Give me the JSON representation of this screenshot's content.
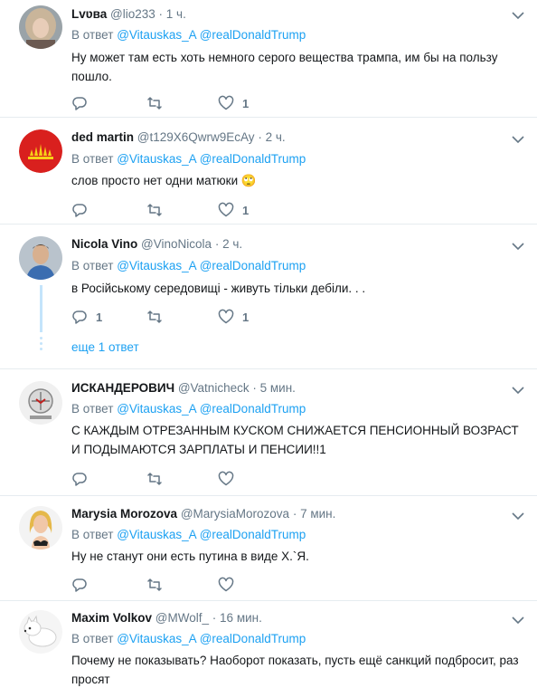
{
  "tweets": [
    {
      "name": "Lvʋва",
      "handle": "@lio233",
      "dot": "·",
      "time": "1 ч.",
      "reply_prefix": "В ответ",
      "mention1": "@Vitauskas_A",
      "mention2": "@realDonaldTrump",
      "text": "Ну может там есть хоть немного серого вещества трампа, им бы на пользу пошло.",
      "reply_count": "",
      "retweet_count": "",
      "like_count": "1"
    },
    {
      "name": "ded martin",
      "handle": "@t129X6Qwrw9EcAy",
      "dot": "·",
      "time": "2 ч.",
      "reply_prefix": "В ответ",
      "mention1": "@Vitauskas_A",
      "mention2": "@realDonaldTrump",
      "text": "слов просто нет одни матюки",
      "emoji": "🙄",
      "reply_count": "",
      "retweet_count": "",
      "like_count": "1"
    },
    {
      "name": "Nicola Vino",
      "handle": "@VinoNicola",
      "dot": "·",
      "time": "2 ч.",
      "reply_prefix": "В ответ",
      "mention1": "@Vitauskas_A",
      "mention2": "@realDonaldTrump",
      "text": "в Російському середовищі - живуть тільки дебіли. . .",
      "reply_count": "1",
      "retweet_count": "",
      "like_count": "1",
      "more_replies": "еще 1 ответ"
    },
    {
      "name": "ИСКАНДЕРОВИЧ",
      "handle": "@Vatnicheck",
      "dot": "·",
      "time": "5 мин.",
      "reply_prefix": "В ответ",
      "mention1": "@Vitauskas_A",
      "mention2": "@realDonaldTrump",
      "text": "С КАЖДЫМ ОТРЕЗАННЫМ КУСКОМ СНИЖАЕТСЯ ПЕНСИОННЫЙ ВОЗРАСТ И ПОДЫМАЮТСЯ ЗАРПЛАТЫ И ПЕНСИИ!!1",
      "reply_count": "",
      "retweet_count": "",
      "like_count": ""
    },
    {
      "name": "Marysia Morozova",
      "handle": "@MarysiaMorozova",
      "dot": "·",
      "time": "7 мин.",
      "reply_prefix": "В ответ",
      "mention1": "@Vitauskas_A",
      "mention2": "@realDonaldTrump",
      "text": "Ну не станут они есть путина в виде Х.`Я.",
      "reply_count": "",
      "retweet_count": "",
      "like_count": ""
    },
    {
      "name": "Maxim Volkov",
      "handle": "@MWolf_",
      "dot": "·",
      "time": "16 мин.",
      "reply_prefix": "В ответ",
      "mention1": "@Vitauskas_A",
      "mention2": "@realDonaldTrump",
      "text": "Почему не показывать? Наоборот показать, пусть ещё санкций подбросит, раз просят",
      "reply_count": "",
      "retweet_count": "",
      "like_count": ""
    }
  ],
  "icons": {
    "reply": "reply-icon",
    "retweet": "retweet-icon",
    "like": "heart-icon",
    "menu": "chevron-down-icon"
  },
  "colors": {
    "link": "#1da1f2",
    "muted": "#657786",
    "text": "#14171a",
    "thread": "#c4e4fb",
    "divider": "#e6ecf0"
  }
}
